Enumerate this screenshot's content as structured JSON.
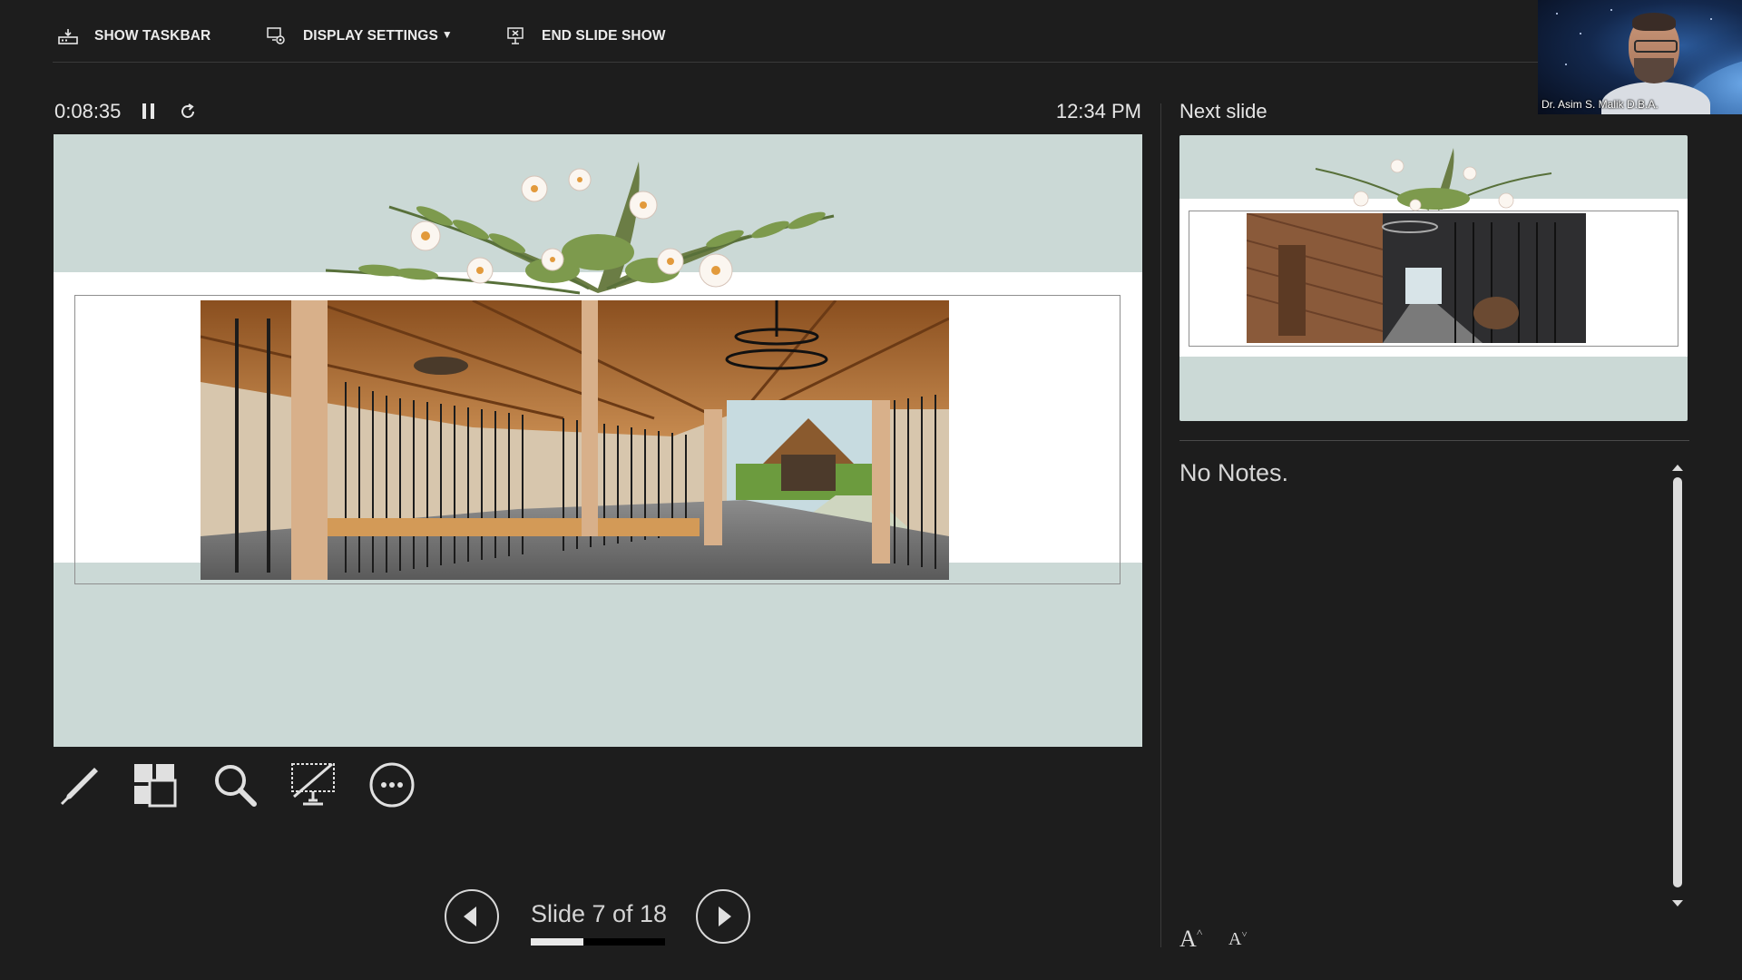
{
  "toolbar": {
    "show_taskbar": "SHOW TASKBAR",
    "display_settings": "DISPLAY SETTINGS",
    "display_settings_arrow": "▼",
    "end_slide_show": "END SLIDE SHOW"
  },
  "webcam": {
    "participant_name": "Dr. Asim S. Malik D.B.A."
  },
  "presenter": {
    "elapsed_time": "0:08:35",
    "clock": "12:34 PM",
    "next_slide_label": "Next slide",
    "notes": "No Notes."
  },
  "navigation": {
    "slide_counter": "Slide 7 of 18",
    "current_slide": 7,
    "total_slides": 18
  },
  "tools": [
    "pen-icon",
    "see-all-slides-icon",
    "zoom-icon",
    "black-screen-icon",
    "more-options-icon"
  ],
  "font_controls": {
    "increase": "A",
    "decrease": "A"
  },
  "colors": {
    "background": "#1d1d1d",
    "slide_background": "#cbd9d6",
    "text": "#e6e6e6"
  }
}
